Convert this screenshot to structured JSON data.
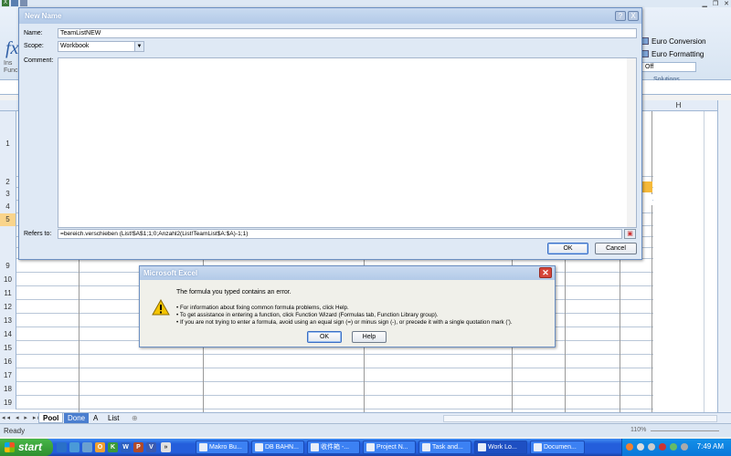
{
  "new_name_dialog": {
    "title": "New Name",
    "help_button": "?",
    "close_button": "X",
    "name_label": "Name:",
    "name_value": "TeamListNEW",
    "scope_label": "Scope:",
    "scope_value": "Workbook",
    "comment_label": "Comment:",
    "comment_value": "",
    "refers_label": "Refers to:",
    "refers_value": "=bereich.verschieben (List!$A$1;1;0;Anzahl2(List!TeamList$A:$A)-1;1)",
    "ok_label": "OK",
    "cancel_label": "Cancel"
  },
  "error_dialog": {
    "title": "Microsoft Excel",
    "message": "The formula you typed contains an error.",
    "bullets": [
      "• For information about fixing common formula problems, click Help.",
      "• To get assistance in entering a function, click Function Wizard (Formulas tab, Function Library group).",
      "• If you are not trying to enter a formula, avoid using an equal sign (=) or minus sign (-), or precede it with a single quotation mark (')."
    ],
    "ok_label": "OK",
    "help_label": "Help"
  },
  "ribbon": {
    "fx_glyph": "fx",
    "insert_label_1": "Ins",
    "insert_label_2": "Func",
    "euro_conversion": "Euro Conversion",
    "euro_formatting": "Euro Formatting",
    "off_value": "Off",
    "solutions_group": "Solutions"
  },
  "grid": {
    "column_h": "H",
    "row_numbers": [
      "1",
      "2",
      "3",
      "4",
      "5",
      "",
      "",
      "",
      "9",
      "10",
      "11",
      "12",
      "13",
      "14",
      "15",
      "16",
      "17",
      "18",
      "19"
    ],
    "selected_row": "5",
    "cell_g3_fragment": "gy",
    "cell_g4_fragment": "ity"
  },
  "sheets": {
    "nav": "◂◂ ◂ ▸ ▸▸",
    "tabs": [
      {
        "label": "Pool",
        "style": "active"
      },
      {
        "label": "Done",
        "style": "blue"
      },
      {
        "label": "A",
        "style": "normal"
      },
      {
        "label": "List",
        "style": "normal"
      }
    ]
  },
  "status": {
    "ready": "Ready",
    "zoom": "110%"
  },
  "taskbar": {
    "start_label": "start",
    "quick_launch": [
      "O",
      "K",
      "W",
      "P",
      "V"
    ],
    "windows": [
      {
        "label": "Makro Bu...",
        "active": false
      },
      {
        "label": "DB BAHN...",
        "active": false
      },
      {
        "label": "收件箱 -...",
        "active": false
      },
      {
        "label": "Project N...",
        "active": false
      },
      {
        "label": "Task and...",
        "active": false
      },
      {
        "label": "Work Lo...",
        "active": true
      },
      {
        "label": "Documen...",
        "active": false
      }
    ],
    "clock": "7:49 AM"
  },
  "colors": {
    "xp_blue": "#245edb",
    "start_green": "#3c9c3c",
    "selected_row_orange": "#f9d48b",
    "error_close_red": "#d6453a",
    "warning_yellow": "#f5c400"
  }
}
